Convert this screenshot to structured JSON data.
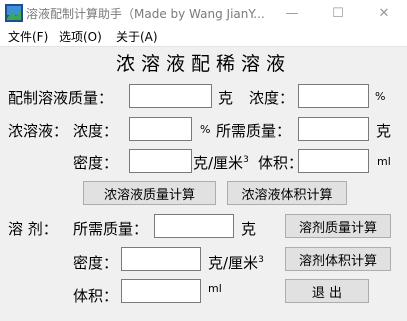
{
  "window": {
    "title": "溶液配制计算助手（Made by Wang JianY...",
    "minimize_glyph": "—",
    "maximize_glyph": "☐",
    "close_glyph": "✕"
  },
  "menu": {
    "file": "文件(F)",
    "options": "选项(O)",
    "about": "关于(A)"
  },
  "heading": "浓溶液配稀溶液",
  "dilute": {
    "mass_label": "配制溶液质量：",
    "mass_value": "",
    "mass_unit": "克",
    "conc_label": "浓度：",
    "conc_value": "",
    "conc_unit": "%"
  },
  "concentrated": {
    "section_label": "浓溶液：",
    "conc_label": "浓度：",
    "conc_value": "",
    "conc_unit": "%",
    "mass_label": "所需质量：",
    "mass_value": "",
    "mass_unit": "克",
    "density_label": "密度：",
    "density_value": "",
    "density_unit": "克/厘米",
    "density_unit_sup": "3",
    "volume_label": "体积：",
    "volume_value": "",
    "volume_unit": "ml",
    "calc_mass_button": "浓溶液质量计算",
    "calc_volume_button": "浓溶液体积计算"
  },
  "solvent": {
    "section_label": "溶 剂：",
    "mass_label": "所需质量：",
    "mass_value": "",
    "mass_unit": "克",
    "density_label": "密度：",
    "density_value": "",
    "density_unit": "克/厘米",
    "density_unit_sup": "3",
    "volume_label": "体积：",
    "volume_value": "",
    "volume_unit": "ml",
    "calc_mass_button": "溶剂质量计算",
    "calc_volume_button": "溶剂体积计算",
    "exit_button": "退  出"
  }
}
